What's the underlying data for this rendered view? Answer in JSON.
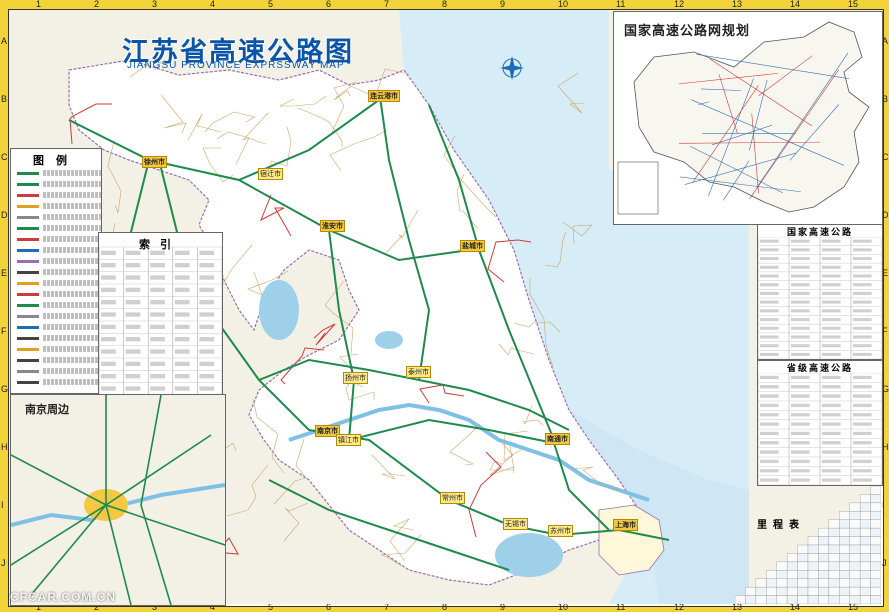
{
  "title": {
    "cn": "江苏省高速公路图",
    "en": "JIANGSU PROVINCE EXPRSSWAY MAP"
  },
  "grid": {
    "columns": [
      "1",
      "2",
      "3",
      "4",
      "5",
      "6",
      "7",
      "8",
      "9",
      "10",
      "11",
      "12",
      "13",
      "14",
      "15"
    ],
    "rows": [
      "A",
      "B",
      "C",
      "D",
      "E",
      "F",
      "G",
      "H",
      "I",
      "J"
    ]
  },
  "legend": {
    "title": "图例"
  },
  "index": {
    "title": "索引"
  },
  "inset_nanjing": {
    "title": "南京周边"
  },
  "inset_national": {
    "title": "国家高速公路网规划"
  },
  "table_national": {
    "title": "国家高速公路"
  },
  "table_provincial": {
    "title": "省级高速公路"
  },
  "distance_table": {
    "title": "里程表"
  },
  "cities": [
    {
      "id": "city-xuzhou",
      "name": "徐州市"
    },
    {
      "id": "city-lianyungang",
      "name": "连云港市"
    },
    {
      "id": "city-suqian",
      "name": "宿迁市"
    },
    {
      "id": "city-huaian",
      "name": "淮安市"
    },
    {
      "id": "city-yancheng",
      "name": "盐城市"
    },
    {
      "id": "city-yangzhou",
      "name": "扬州市"
    },
    {
      "id": "city-taizhou",
      "name": "泰州市"
    },
    {
      "id": "city-nantong",
      "name": "南通市"
    },
    {
      "id": "city-nanjing",
      "name": "南京市"
    },
    {
      "id": "city-zhenjiang",
      "name": "镇江市"
    },
    {
      "id": "city-changzhou",
      "name": "常州市"
    },
    {
      "id": "city-wuxi",
      "name": "无锡市"
    },
    {
      "id": "city-suzhou",
      "name": "苏州市"
    },
    {
      "id": "city-shanghai",
      "name": "上海市"
    }
  ],
  "watermark": "CFCAR.COM.CN",
  "colors": {
    "border": "#f2d43a",
    "sea": "#d6ecf7",
    "land": "#f3f1e6",
    "province": "#ffffff",
    "expressway": "#1f8a4c",
    "national_road": "#d03a3a",
    "title": "#0b55a8",
    "lake": "#9fd0ea"
  }
}
